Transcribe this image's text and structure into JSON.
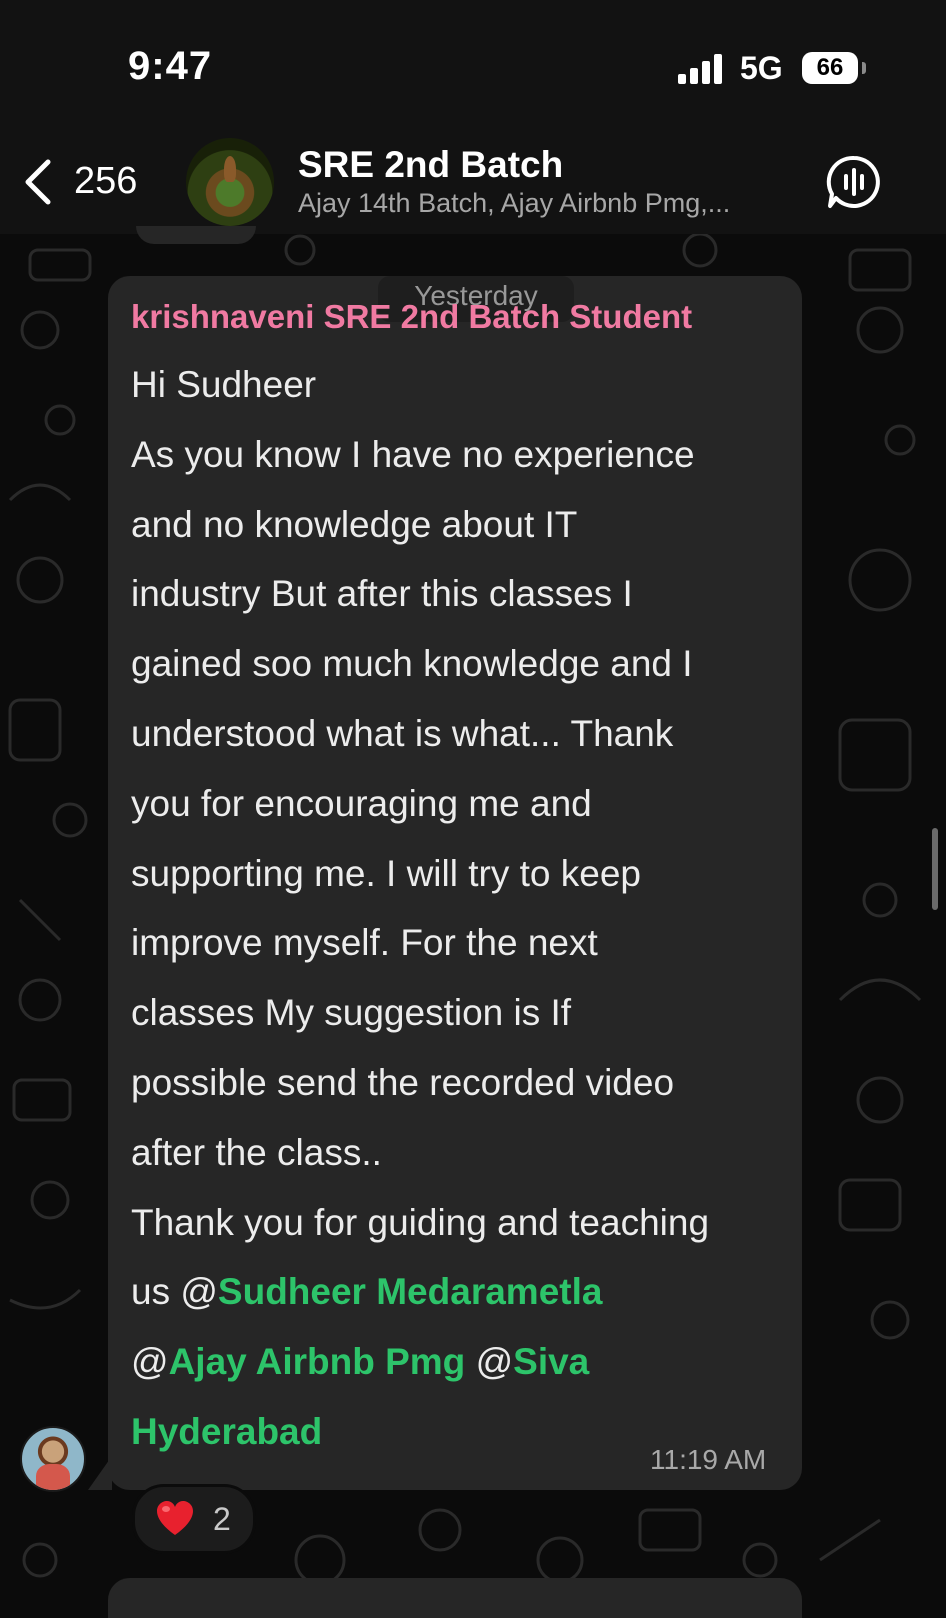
{
  "status_bar": {
    "time": "9:47",
    "network": "5G",
    "battery": "66"
  },
  "header": {
    "unread_count": "256",
    "title": "SRE 2nd Batch",
    "subtitle": "Ajay 14th Batch, Ajay Airbnb Pmg,..."
  },
  "date_separator": "Yesterday",
  "message": {
    "sender": "krishnaveni SRE 2nd Batch Student",
    "lines": [
      "Hi Sudheer",
      "As you know I have no experience",
      "and no knowledge about IT",
      "industry But after this classes I",
      "gained soo much knowledge and I",
      "understood what is what... Thank",
      "you for encouraging me and",
      "supporting me. I will try to keep",
      "improve myself. For the next",
      "classes My suggestion is If",
      "possible  send the recorded video",
      "after the class..",
      "Thank you for guiding and teaching"
    ],
    "mention_prefix": "us ",
    "mentions": [
      "Sudheer Medarametla",
      "Ajay Airbnb Pmg",
      "Siva",
      "Hyderabad"
    ],
    "at_symbol": "@",
    "time": "11:19 AM"
  },
  "reaction": {
    "emoji": "heart-emoji",
    "count": "2"
  },
  "colors": {
    "sender": "#f07aa2",
    "mention": "#2dc46a",
    "bubble": "#262626"
  }
}
